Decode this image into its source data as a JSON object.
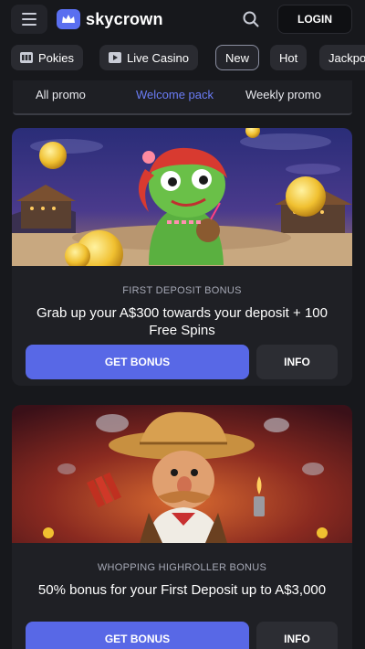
{
  "header": {
    "logo_text": "skycrown",
    "login_label": "LOGIN",
    "icons": [
      "menu-icon",
      "crown-icon",
      "search-icon"
    ]
  },
  "categories": [
    {
      "label": "Pokies",
      "icon": "slot-machine-icon"
    },
    {
      "label": "Live Casino",
      "icon": "play-icon"
    },
    {
      "label": "New",
      "icon": ""
    },
    {
      "label": "Hot",
      "icon": ""
    },
    {
      "label": "Jackpo",
      "icon": ""
    }
  ],
  "promo_tabs": [
    "All promo",
    "Welcome pack",
    "Weekly promo"
  ],
  "active_tab": "Welcome pack",
  "promos": [
    {
      "kicker": "FIRST DEPOSIT BONUS",
      "title": "Grab up your A$300 towards your deposit + 100 Free Spins",
      "bonus_label": "GET BONUS",
      "info_label": "INFO"
    },
    {
      "kicker": "WHOPPING HIGHROLLER BONUS",
      "title": "50% bonus for your First Deposit up to A$3,000",
      "bonus_label": "GET BONUS",
      "info_label": "INFO"
    }
  ],
  "colors": {
    "accent": "#5868e6",
    "active_tab": "#6a7cf5",
    "background": "#17181c"
  }
}
